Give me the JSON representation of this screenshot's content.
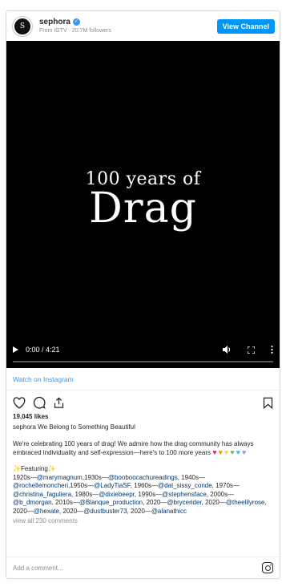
{
  "header": {
    "username": "sephora",
    "subtitle": "From IGTV · 20.7M followers",
    "view_channel_label": "View Channel",
    "avatar_text": "S"
  },
  "video": {
    "title_line1": "100 years of",
    "title_line2": "Drag",
    "time": "0:00 / 4:21",
    "progress_fraction": 0
  },
  "watch_label": "Watch on Instagram",
  "likes": "19,045 likes",
  "caption": {
    "username": "sephora",
    "title": "We Belong to Something Beautiful",
    "body": "We're celebrating 100 years of drag! We admire how the drag community has always embraced individuality and self-expression—here's to 100 more years",
    "hearts": [
      "#e0245e",
      "#f4900c",
      "#fdcb58",
      "#78b159",
      "#55acee",
      "#aa8ed6"
    ],
    "featuring_label": "Featuring",
    "credits": [
      {
        "text": "1920s—",
        "mention": "@marymagnum"
      },
      {
        "text": ",1930s—",
        "mention": "@booboocachureadings"
      },
      {
        "text": ", 1940s—",
        "mention": "@rochellemoncheri"
      },
      {
        "text": ",1950s—",
        "mention": "@LadyTiaSF"
      },
      {
        "text": ", 1960s—",
        "mention": "@dat_sissy_conde"
      },
      {
        "text": ", 1970s—",
        "mention": "@christina_faguliera"
      },
      {
        "text": ", 1980s—",
        "mention": "@dixiebeepr"
      },
      {
        "text": ", 1990s—",
        "mention": "@stephensface"
      },
      {
        "text": ", 2000s—",
        "mention": "@b_dmorgan"
      },
      {
        "text": ", 2010s—",
        "mention": "@Blanque_production"
      },
      {
        "text": ", 2020—",
        "mention": "@brycerider"
      },
      {
        "text": ", 2020—",
        "mention": "@theelilyrose"
      },
      {
        "text": ", 2020—",
        "mention": "@hexate"
      },
      {
        "text": ", 2020—",
        "mention": "@dustbuster73"
      },
      {
        "text": ", 2020—",
        "mention": "@alanathicc"
      }
    ],
    "view_all": "view all 230 comments"
  },
  "comment_placeholder": "Add a comment...",
  "icons": {
    "like": "heart-outline-icon",
    "comment": "comment-bubble-icon",
    "share": "share-icon",
    "save": "bookmark-icon",
    "play": "play-icon",
    "volume": "volume-icon",
    "fullscreen": "fullscreen-icon",
    "more": "more-vertical-icon",
    "instagram": "instagram-logo-icon"
  },
  "colors": {
    "accent": "#0095f6",
    "link": "#00376b",
    "video_bg": "#000000"
  }
}
